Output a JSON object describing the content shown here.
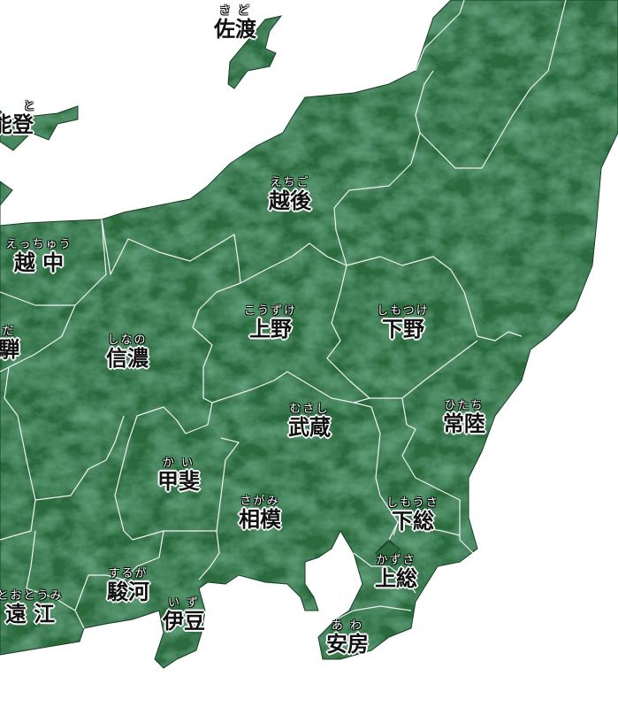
{
  "map": {
    "colors": {
      "land": "#2c6a3e",
      "land_light": "#4a9463",
      "land_dark": "#16442a",
      "border": "#f2f2f2",
      "sea": "#ffffff"
    },
    "provinces": [
      {
        "key": "sado",
        "furigana": "さ ど",
        "name": "佐渡"
      },
      {
        "key": "noto",
        "furigana": "と",
        "name": "能登"
      },
      {
        "key": "echigo",
        "furigana": "えちご",
        "name": "越後"
      },
      {
        "key": "etchu",
        "furigana": "えっちゅう",
        "name": "越 中"
      },
      {
        "key": "hida",
        "furigana": "だ",
        "name": "騨"
      },
      {
        "key": "shinano",
        "furigana": "しなの",
        "name": "信濃"
      },
      {
        "key": "kozuke",
        "furigana": "こうずけ",
        "name": "上野"
      },
      {
        "key": "shimotsuke",
        "furigana": "しもつけ",
        "name": "下野"
      },
      {
        "key": "hitachi",
        "furigana": "ひたち",
        "name": "常陸"
      },
      {
        "key": "musashi",
        "furigana": "むさし",
        "name": "武蔵"
      },
      {
        "key": "kai",
        "furigana": "か い",
        "name": "甲斐"
      },
      {
        "key": "sagami",
        "furigana": "さがみ",
        "name": "相模"
      },
      {
        "key": "shimousa",
        "furigana": "しもうさ",
        "name": "下総"
      },
      {
        "key": "kazusa",
        "furigana": "かずさ",
        "name": "上総"
      },
      {
        "key": "awa",
        "furigana": "あ わ",
        "name": "安房"
      },
      {
        "key": "suruga",
        "furigana": "するが",
        "name": "駿河"
      },
      {
        "key": "izu",
        "furigana": "い ず",
        "name": "伊豆"
      },
      {
        "key": "totomi",
        "furigana": "とおとうみ",
        "name": "遠 江"
      }
    ]
  }
}
